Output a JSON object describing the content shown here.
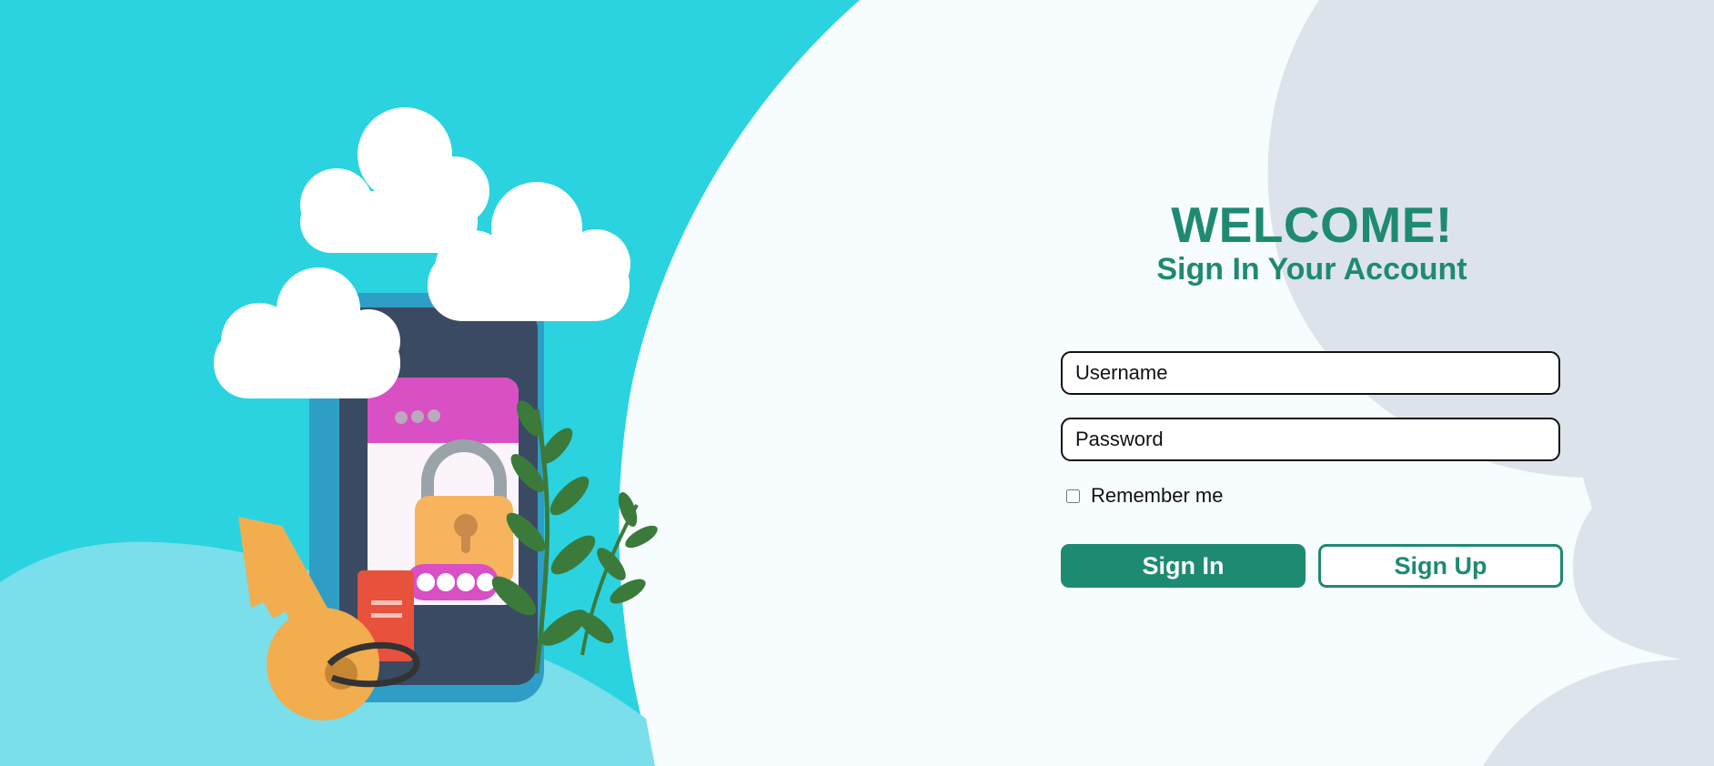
{
  "colors": {
    "accent": "#1e8a72",
    "left_background": "#2bd3e0",
    "left_hill": "#7adfeb",
    "right_background": "#f7fdfe",
    "decor_blob": "#dde3ea"
  },
  "header": {
    "title": "WELCOME!",
    "subtitle": "Sign In Your Account"
  },
  "form": {
    "username_placeholder": "Username",
    "username_value": "",
    "password_placeholder": "Password",
    "password_value": "",
    "remember_label": "Remember me",
    "remember_checked": false,
    "sign_in_label": "Sign In",
    "sign_up_label": "Sign Up"
  },
  "illustration": {
    "icons": [
      "cloud-icon",
      "phone-icon",
      "padlock-icon",
      "key-icon",
      "plant-icon",
      "note-icon"
    ]
  }
}
